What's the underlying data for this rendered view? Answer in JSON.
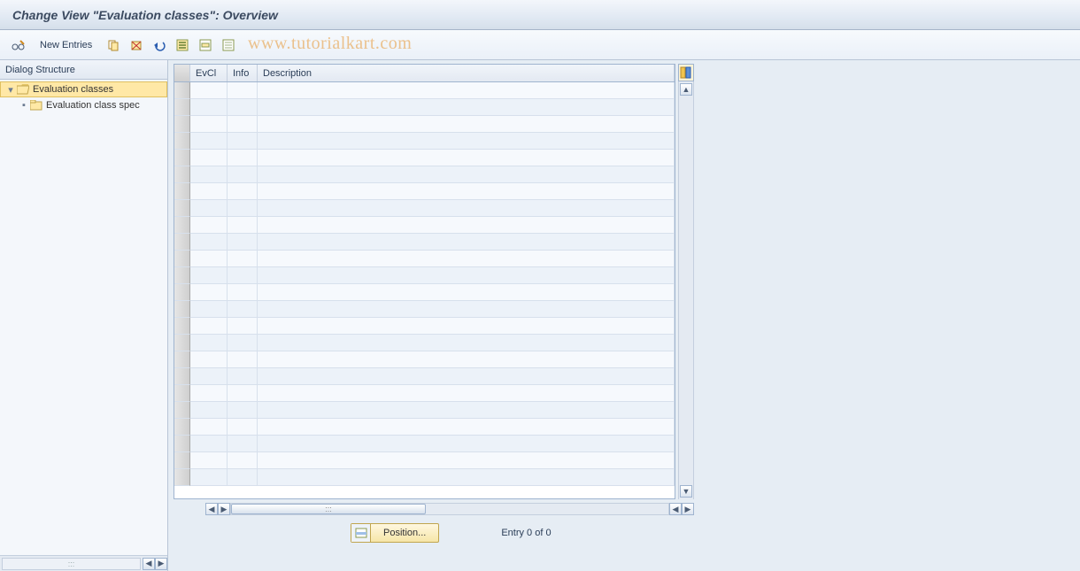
{
  "title": "Change View \"Evaluation classes\": Overview",
  "watermark": "www.tutorialkart.com",
  "toolbar": {
    "new_entries_label": "New Entries"
  },
  "dialog_structure": {
    "header": "Dialog Structure",
    "items": [
      {
        "label": "Evaluation classes",
        "selected": true
      },
      {
        "label": "Evaluation class spec",
        "selected": false
      }
    ]
  },
  "table": {
    "columns": [
      {
        "key": "evcl",
        "label": "EvCl"
      },
      {
        "key": "info",
        "label": "Info"
      },
      {
        "key": "description",
        "label": "Description"
      }
    ],
    "row_count": 24
  },
  "footer": {
    "position_label": "Position...",
    "entry_status": "Entry 0 of 0"
  }
}
